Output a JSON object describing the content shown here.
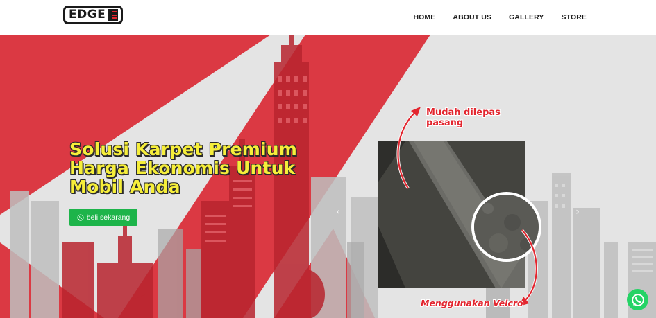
{
  "brand": {
    "logo_text": "EDGE"
  },
  "nav": {
    "items": [
      "HOME",
      "ABOUT US",
      "GALLERY",
      "STORE"
    ]
  },
  "hero": {
    "headline": [
      "Solusi Karpet Premium",
      "Harga Ekonomis Untuk",
      "Mobil Anda"
    ],
    "cta_label": "beli sekarang",
    "annotations": {
      "top": [
        "Mudah dilepas",
        "pasang"
      ],
      "bottom": "Menggunakan Velcro"
    },
    "colors": {
      "red": "#db3943",
      "headline": "#f6ee3a",
      "cta": "#1db44a"
    }
  },
  "icons": {
    "whatsapp": "whatsapp-icon",
    "prev": "chevron-left-icon",
    "next": "chevron-right-icon"
  }
}
